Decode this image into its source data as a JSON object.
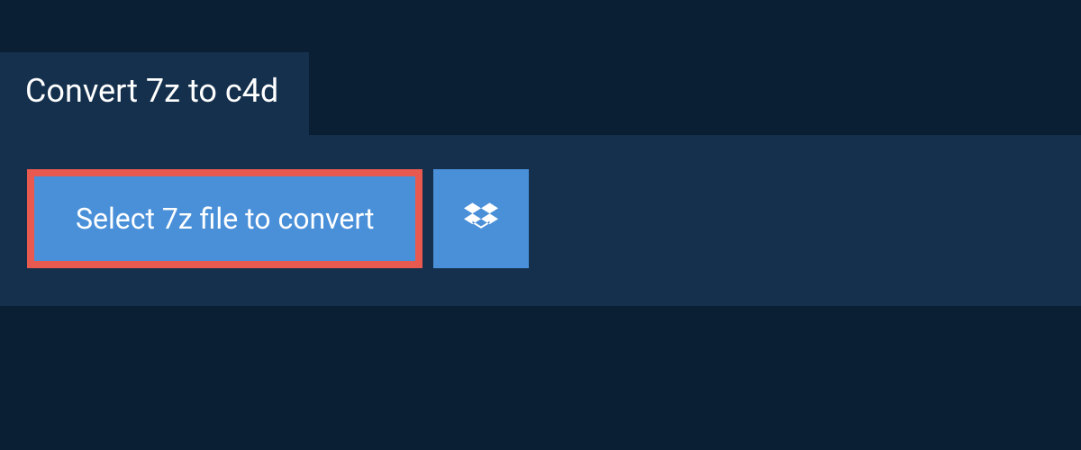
{
  "header": {
    "title": "Convert 7z to c4d"
  },
  "actions": {
    "select_label": "Select 7z file to convert",
    "dropbox_icon": "dropbox"
  },
  "colors": {
    "page_bg": "#0a1f33",
    "panel_bg": "#14304d",
    "button_bg": "#4a90d9",
    "highlight_border": "#e85a4f",
    "text": "#ffffff"
  }
}
